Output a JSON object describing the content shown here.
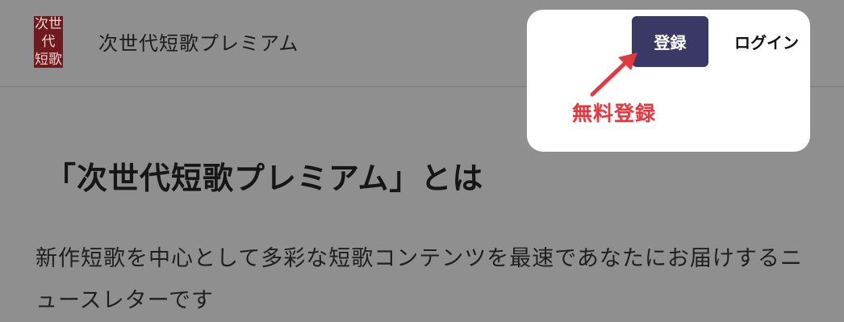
{
  "header": {
    "logo_lines": [
      "次世代",
      "短歌"
    ],
    "site_title": "次世代短歌プレミアム",
    "register_label": "登録",
    "login_label": "ログイン"
  },
  "annotation": {
    "label": "無料登録",
    "color": "#e2383f",
    "icon": "arrow-icon"
  },
  "main": {
    "title": "「次世代短歌プレミアム」とは",
    "description": "新作短歌を中心として多彩な短歌コンテンツを最速であなたにお届けするニュースレターです"
  },
  "colors": {
    "overlay": "#8f8f8f",
    "register_button": "#3a3865",
    "logo_bg": "#6e1a1e"
  }
}
